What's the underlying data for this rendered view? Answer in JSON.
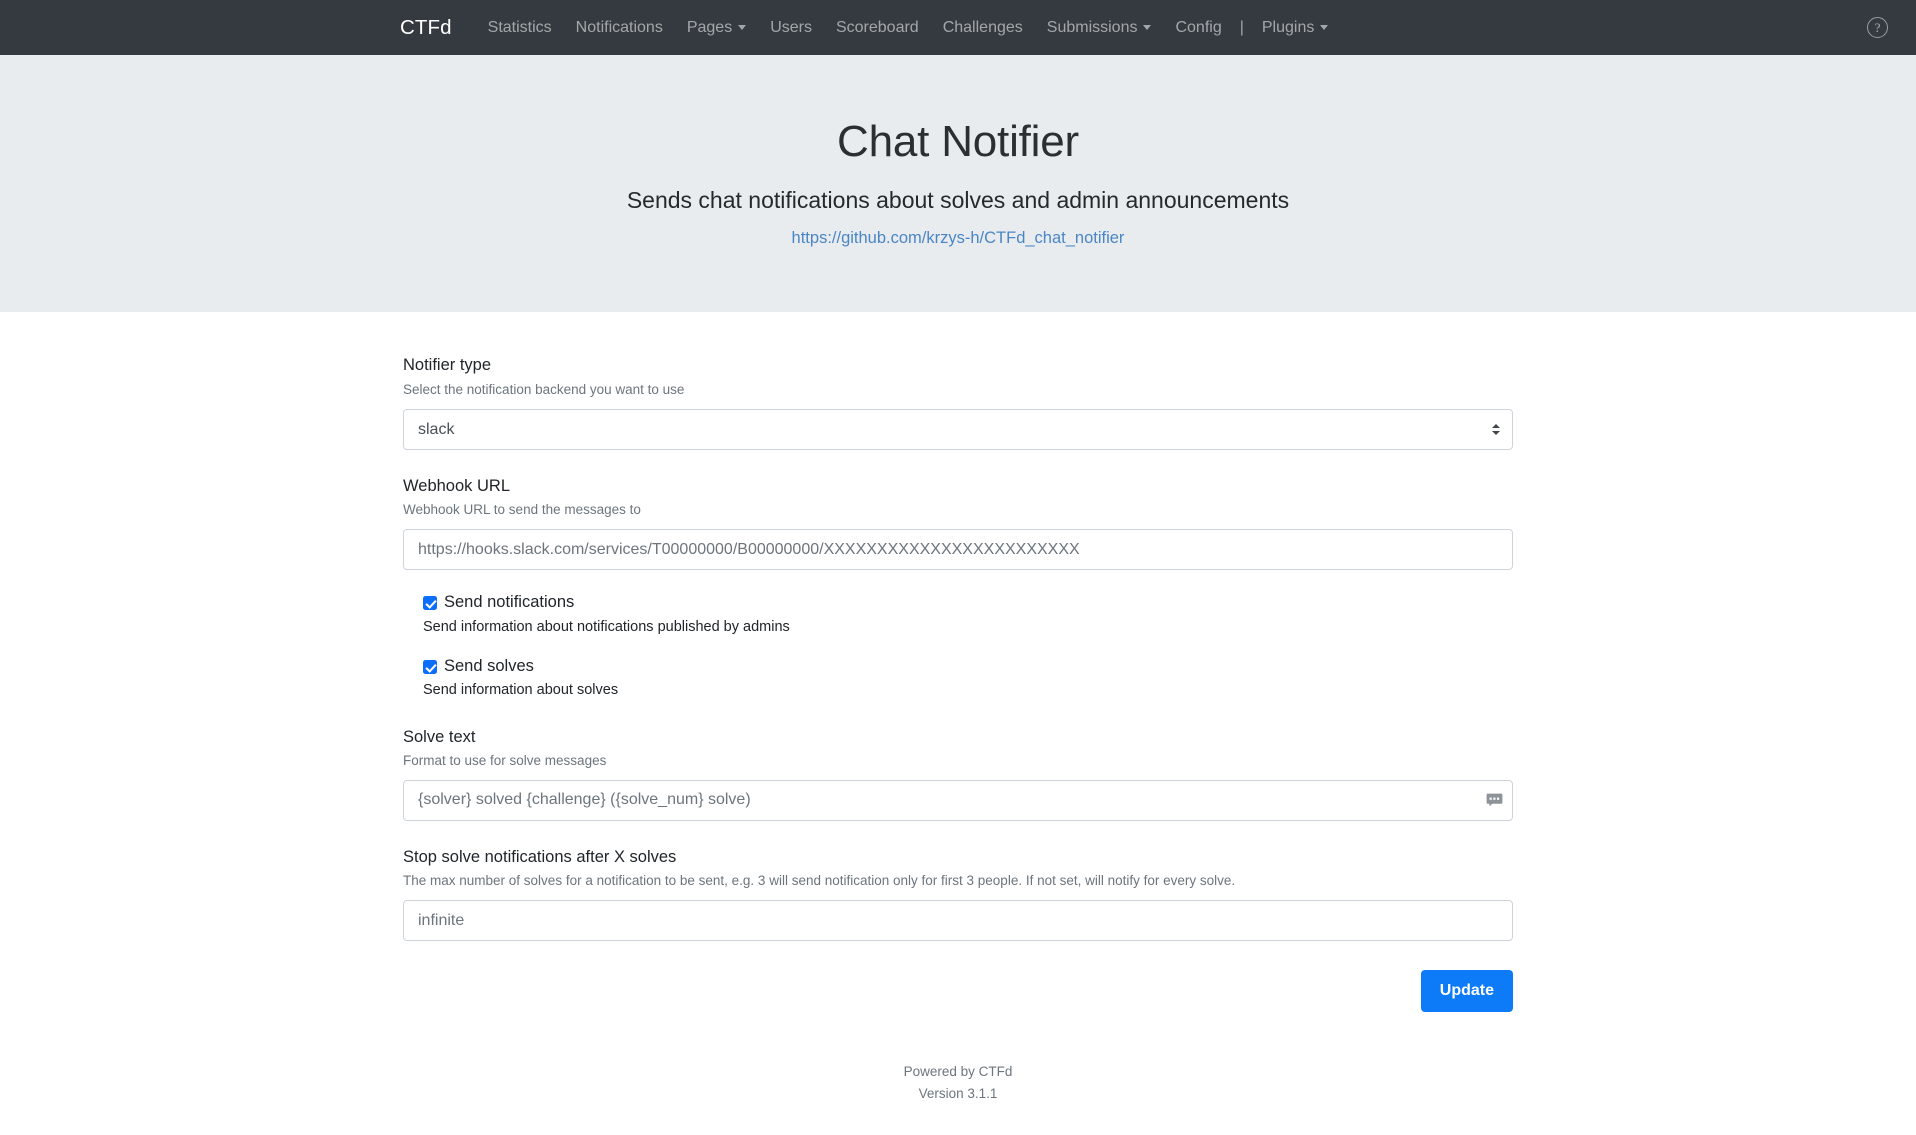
{
  "navbar": {
    "brand": "CTFd",
    "items": [
      {
        "label": "Statistics",
        "caret": false
      },
      {
        "label": "Notifications",
        "caret": false
      },
      {
        "label": "Pages",
        "caret": true
      },
      {
        "label": "Users",
        "caret": false
      },
      {
        "label": "Scoreboard",
        "caret": false
      },
      {
        "label": "Challenges",
        "caret": false
      },
      {
        "label": "Submissions",
        "caret": true
      },
      {
        "label": "Config",
        "caret": false
      }
    ],
    "divider": "|",
    "plugins": {
      "label": "Plugins",
      "caret": true
    },
    "help_icon": "?",
    "bg_color": "#343a40",
    "link_color": "rgba(255,255,255,0.55)"
  },
  "jumbotron": {
    "title": "Chat Notifier",
    "subtitle": "Sends chat notifications about solves and admin announcements",
    "link_text": "https://github.com/krzys-h/CTFd_chat_notifier",
    "bg_color": "#e9ecef",
    "link_color": "#4a86c5"
  },
  "form": {
    "notifier_type": {
      "label": "Notifier type",
      "help": "Select the notification backend you want to use",
      "value": "slack",
      "options": [
        "slack"
      ],
      "icon": "select-updown-icon"
    },
    "webhook_url": {
      "label": "Webhook URL",
      "help": "Webhook URL to send the messages to",
      "value": "",
      "placeholder": "https://hooks.slack.com/services/T00000000/B00000000/XXXXXXXXXXXXXXXXXXXXXXXX"
    },
    "send_notifications": {
      "label": "Send notifications",
      "help": "Send information about notifications published by admins",
      "checked": true
    },
    "send_solves": {
      "label": "Send solves",
      "help": "Send information about solves",
      "checked": true
    },
    "solve_text": {
      "label": "Solve text",
      "help": "Format to use for solve messages",
      "value": "",
      "placeholder": "{solver} solved {challenge} ({solve_num} solve)",
      "icon": "comment-bubble-icon"
    },
    "stop_after": {
      "label": "Stop solve notifications after X solves",
      "help": "The max number of solves for a notification to be sent, e.g. 3 will send notification only for first 3 people. If not set, will notify for every solve.",
      "value": "",
      "placeholder": "infinite"
    },
    "submit": {
      "label": "Update",
      "color": "#0d7bf7"
    }
  },
  "footer": {
    "powered_by": "Powered by CTFd",
    "version": "Version 3.1.1"
  }
}
